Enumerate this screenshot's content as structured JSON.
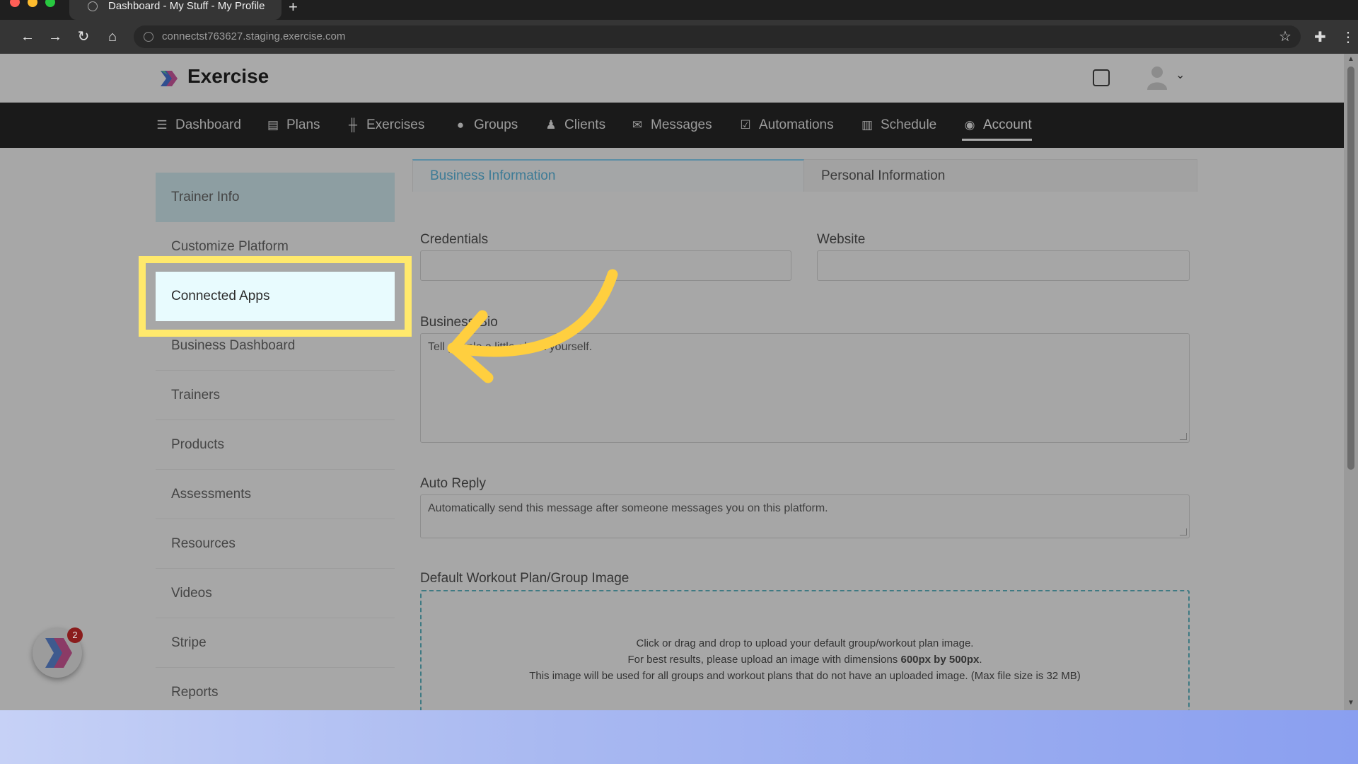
{
  "browser": {
    "tab_title": "Dashboard - My Stuff - My Profile",
    "new_tab": "+",
    "url": "connectst763627.staging.exercise.com"
  },
  "app": {
    "brand": "Exercise"
  },
  "nav": [
    {
      "label": "Dashboard",
      "icon": "list-icon"
    },
    {
      "label": "Plans",
      "icon": "clipboard-icon"
    },
    {
      "label": "Exercises",
      "icon": "dumbbell-icon"
    },
    {
      "label": "Groups",
      "icon": "users-icon"
    },
    {
      "label": "Clients",
      "icon": "user-icon"
    },
    {
      "label": "Messages",
      "icon": "envelope-icon"
    },
    {
      "label": "Automations",
      "icon": "check-square-icon"
    },
    {
      "label": "Schedule",
      "icon": "calendar-icon"
    },
    {
      "label": "Account",
      "icon": "user-circle-icon"
    }
  ],
  "sidebar": {
    "items": [
      {
        "label": "Trainer Info"
      },
      {
        "label": "Customize Platform"
      },
      {
        "label": "Connected Apps"
      },
      {
        "label": "Business Dashboard"
      },
      {
        "label": "Trainers"
      },
      {
        "label": "Products"
      },
      {
        "label": "Assessments"
      },
      {
        "label": "Resources"
      },
      {
        "label": "Videos"
      },
      {
        "label": "Stripe"
      },
      {
        "label": "Reports"
      }
    ]
  },
  "tabs": {
    "business": "Business Information",
    "personal": "Personal Information"
  },
  "form": {
    "credentials_label": "Credentials",
    "website_label": "Website",
    "bio_label": "Business Bio",
    "bio_placeholder": "Tell people a little about yourself.",
    "auto_reply_label": "Auto Reply",
    "auto_reply_placeholder": "Automatically send this message after someone messages you on this platform.",
    "image_label": "Default Workout Plan/Group Image"
  },
  "dropzone": {
    "line1": "Click or drag and drop to upload your default group/workout plan image.",
    "line2_pre": "For best results, please upload an image with dimensions ",
    "line2_bold": "600px by 500px",
    "line2_post": ".",
    "line3": "This image will be used for all groups and workout plans that do not have an uploaded image. (Max file size is 32 MB)"
  },
  "badge_count": "2",
  "colors": {
    "highlight_frame": "#ffe96c",
    "arrow": "#ffcf3f",
    "active_tab_text": "#3d7b96"
  }
}
